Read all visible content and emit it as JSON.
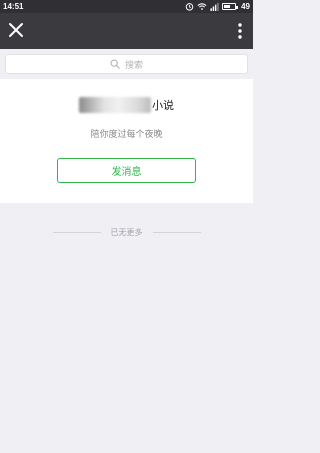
{
  "status_bar": {
    "time": "14:51",
    "battery": "49",
    "icons": [
      "alarm-icon",
      "wifi-icon",
      "signal-icon",
      "battery-icon"
    ]
  },
  "toolbar": {
    "close_icon": "close-icon",
    "more_icon": "more-vertical-icon"
  },
  "search": {
    "placeholder": "搜索",
    "icon": "search-icon"
  },
  "profile": {
    "name_suffix": "小说",
    "subtitle": "陪你度过每个夜晚",
    "send_button": "发消息"
  },
  "list_footer": {
    "no_more": "已无更多"
  },
  "colors": {
    "accent_green": "#2fb54c",
    "toolbar_bg": "#3a3a3f",
    "page_bg": "#efeff4"
  }
}
